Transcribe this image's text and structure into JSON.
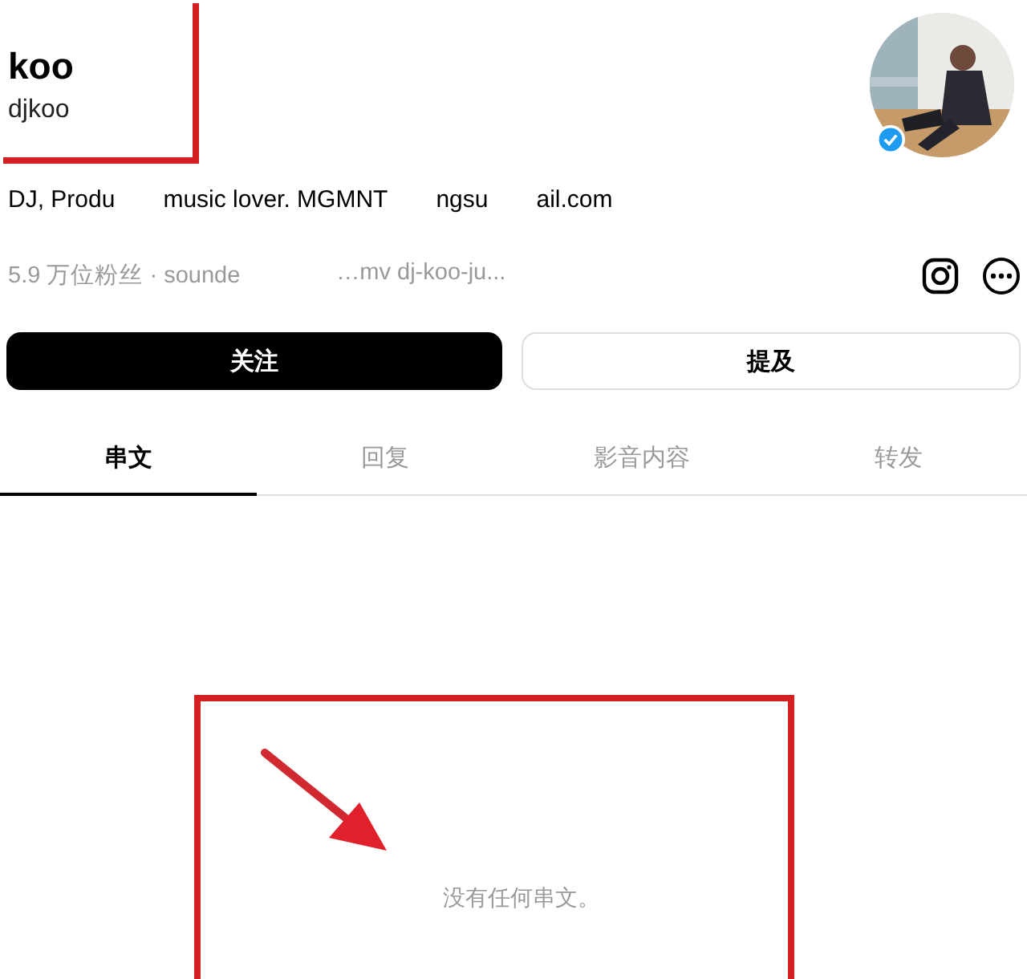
{
  "profile": {
    "name": "koo",
    "handle": "djkoo",
    "verified": true,
    "bio_fragments": [
      "DJ, Produ",
      "music lover. MGMNT",
      "ngsu",
      "ail.com"
    ],
    "meta_fragments": [
      "5.9 万位粉丝 · sounde",
      "…mv dj-koo-ju..."
    ]
  },
  "buttons": [
    {
      "label": "关注",
      "kind": "primary"
    },
    {
      "label": "提及",
      "kind": "secondary"
    }
  ],
  "tabs": [
    {
      "label": "串文",
      "selected": true
    },
    {
      "label": "回复",
      "selected": false
    },
    {
      "label": "影音内容",
      "selected": false
    },
    {
      "label": "转发",
      "selected": false
    }
  ],
  "empty_message": "没有任何串文。"
}
